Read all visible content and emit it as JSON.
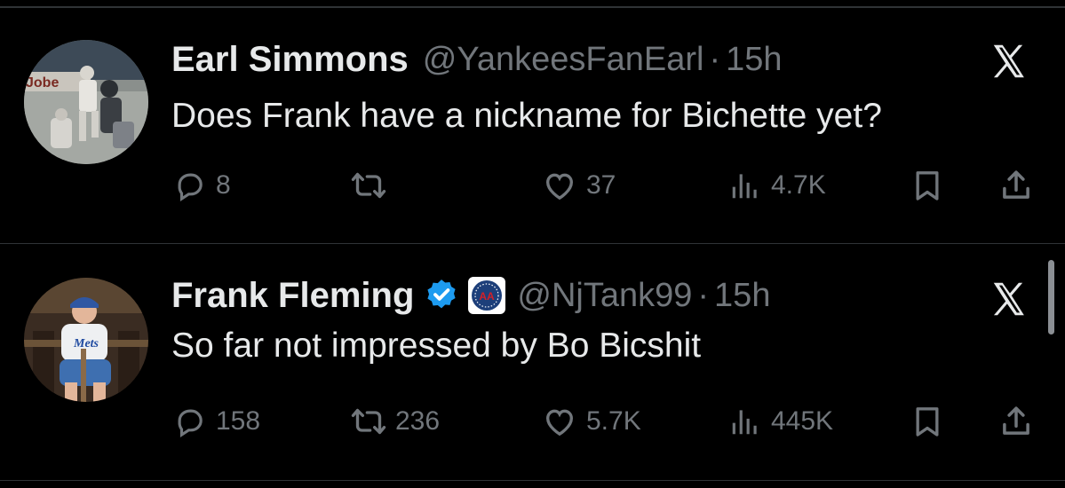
{
  "tweets": [
    {
      "name": "Earl Simmons",
      "handle": "@YankeesFanEarl",
      "dot": "·",
      "time": "15h",
      "text": "Does Frank have a nickname for Bichette yet?",
      "avatar_text": "Jobe",
      "stats": {
        "replies": "8",
        "retweets": "",
        "likes": "37",
        "views": "4.7K"
      }
    },
    {
      "name": "Frank Fleming",
      "handle": "@NjTank99",
      "dot": "·",
      "time": "15h",
      "text": "So far not impressed by Bo Bicshit",
      "affiliate_mark": "AA",
      "stats": {
        "replies": "158",
        "retweets": "236",
        "likes": "5.7K",
        "views": "445K"
      }
    }
  ],
  "colors": {
    "background": "#000000",
    "text": "#e7e9ea",
    "muted": "#71767b",
    "verified": "#1d9bf0",
    "divider": "#2f3336"
  },
  "icons": [
    "reply-icon",
    "retweet-icon",
    "like-icon",
    "views-icon",
    "bookmark-icon",
    "share-icon",
    "x-logo-icon",
    "verified-badge-icon"
  ]
}
